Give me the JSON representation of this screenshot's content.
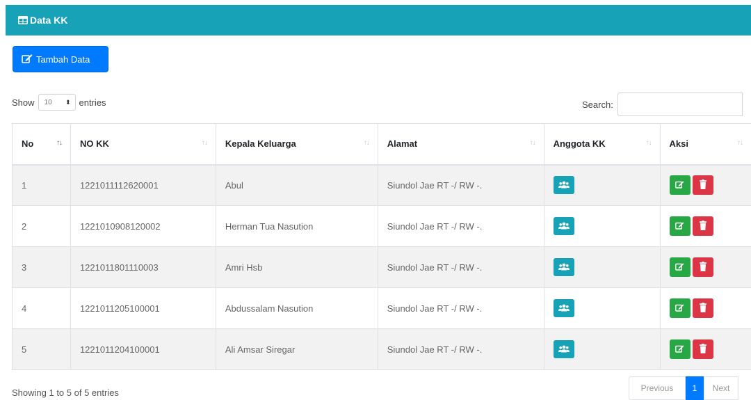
{
  "header": {
    "title": "Data KK",
    "icon": "table-icon"
  },
  "toolbar": {
    "add_label": "Tambah Data",
    "add_icon": "edit-icon"
  },
  "length": {
    "show_label": "Show",
    "value": "10",
    "entries_label": "entries"
  },
  "search": {
    "label": "Search:",
    "value": ""
  },
  "table": {
    "columns": [
      "No",
      "NO KK",
      "Kepala Keluarga",
      "Alamat",
      "Anggota KK",
      "Aksi"
    ],
    "rows": [
      {
        "no": "1",
        "no_kk": "1221011112620001",
        "kepala": "Abul",
        "alamat": "Siundol Jae RT -/ RW -."
      },
      {
        "no": "2",
        "no_kk": "1221010908120002",
        "kepala": "Herman Tua Nasution",
        "alamat": "Siundol Jae RT -/ RW -."
      },
      {
        "no": "3",
        "no_kk": "1221011801110003",
        "kepala": "Amri Hsb",
        "alamat": "Siundol Jae RT -/ RW -."
      },
      {
        "no": "4",
        "no_kk": "1221011205100001",
        "kepala": "Abdussalam Nasution",
        "alamat": "Siundol Jae RT -/ RW -."
      },
      {
        "no": "5",
        "no_kk": "1221011204100001",
        "kepala": "Ali Amsar Siregar",
        "alamat": "Siundol Jae RT -/ RW -."
      }
    ]
  },
  "footer": {
    "info": "Showing 1 to 5 of 5 entries",
    "prev_label": "Previous",
    "current_page": "1",
    "next_label": "Next"
  },
  "colors": {
    "header": "#17a2b8",
    "primary": "#007bff",
    "success": "#28a745",
    "danger": "#dc3545"
  }
}
